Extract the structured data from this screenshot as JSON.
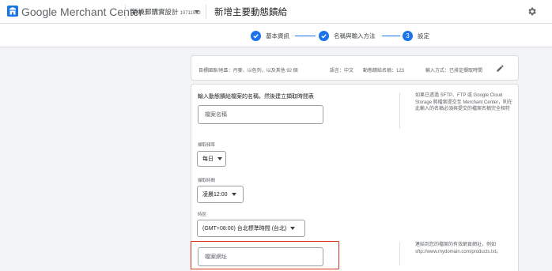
{
  "header": {
    "logo_icon": "merchant-center-logo-icon",
    "app_title": "Google Merchant Center",
    "account_name": "新境郵購實設計",
    "account_id": "10711952",
    "page_title": "新增主要動態饋給",
    "settings_icon": "gear-icon"
  },
  "stepper": {
    "steps": [
      {
        "label": "基本資訊",
        "state": "done"
      },
      {
        "label": "名稱與輸入方法",
        "state": "done"
      },
      {
        "label": "設定",
        "number": "3",
        "state": "current"
      }
    ],
    "accent_color": "#1a73e8"
  },
  "summary": {
    "target": "目標國家/地區：丹麥、以色列，以及其他 92 個",
    "language": "語言：中文",
    "feed_name": "動態饋給名稱：123",
    "input_method": "輸入方式：已排定擷取時間",
    "edit_icon": "pencil-icon"
  },
  "main": {
    "section_title": "輸入動態饋給檔案的名稱，然後建立擷取時間表",
    "help_text_1": "如果已透過 SFTP、FTP 或 Google Cloud Storage 將檔案提交至 Merchant Center，則在此輸入的名稱必須與提交的檔案名稱完全相符",
    "file_name_placeholder": "檔案名稱",
    "frequency_label": "擷取頻率",
    "frequency_value": "每日",
    "time_label": "擷取時間",
    "time_value": "凌晨12:00",
    "timezone_label": "時區",
    "timezone_value": "(GMT+08:00) 台北標準時間 (台北)",
    "file_url_placeholder": "檔案網址",
    "help_text_2": "連結到您的檔案的有效網頁網址，例如 sftp://www.mydomain.com/products.txt。"
  },
  "highlight_color": "#d93025"
}
